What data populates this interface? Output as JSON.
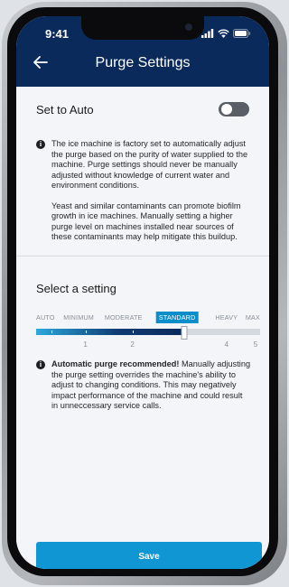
{
  "status_bar": {
    "time": "9:41"
  },
  "header": {
    "title": "Purge Settings"
  },
  "auto": {
    "label": "Set to Auto",
    "enabled": false
  },
  "info": {
    "paragraph1": "The ice machine is factory set to automatically adjust the purge based on the purity of water supplied to the machine. Purge settings should never be manually adjusted without knowledge of current water and environment conditions.",
    "paragraph2": "Yeast and similar contaminants can promote biofilm growth in ice machines. Manually setting a higher purge level on machines installed near sources of these contaminants may help mitigate this buildup."
  },
  "select": {
    "title": "Select a setting",
    "levels": [
      "AUTO",
      "MINIMUM",
      "MODERATE",
      "STANDARD",
      "HEAVY",
      "MAX"
    ],
    "selected": "STANDARD",
    "numbers": [
      "1",
      "2",
      "4",
      "5"
    ],
    "slider_fraction": 0.66
  },
  "recommendation": {
    "bold": "Automatic purge recommended!",
    "text": " Manually adjusting the purge setting overrides the machine's ability to adjust to changing conditions. This may negatively impact performance of the machine and could result in unneccessary service calls."
  },
  "save_label": "Save",
  "colors": {
    "header": "#0b2a5c",
    "accent": "#1097d3",
    "selected_badge": "#0a8ec9"
  },
  "icons": [
    "back-arrow-icon",
    "signal-icon",
    "wifi-icon",
    "battery-icon",
    "info-icon"
  ]
}
